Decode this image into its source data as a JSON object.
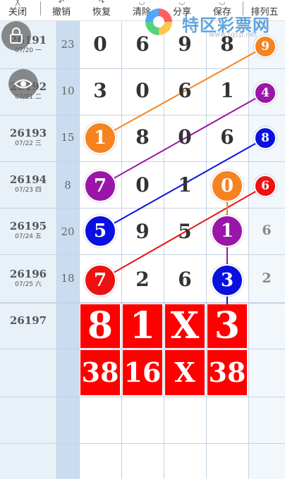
{
  "toolbar": {
    "items": [
      {
        "label": "关闭",
        "icon": "close-icon"
      },
      {
        "label": "撤销",
        "icon": "undo-icon"
      },
      {
        "label": "恢复",
        "icon": "redo-icon"
      },
      {
        "label": "清除",
        "icon": "clear-icon"
      },
      {
        "label": "分享",
        "icon": "share-icon"
      },
      {
        "label": "保存",
        "icon": "save-icon"
      },
      {
        "label": "排列五",
        "icon": "lottery-type"
      }
    ]
  },
  "watermark": {
    "text": "特区彩票网",
    "url": "www.tqcp.net"
  },
  "rows": [
    {
      "issue": "26191",
      "date": "07/20 一",
      "sum": "23",
      "digits": [
        "0",
        "6",
        "9",
        "8"
      ],
      "last": "9"
    },
    {
      "issue": "26192",
      "date": "07/21 二",
      "sum": "10",
      "digits": [
        "3",
        "0",
        "6",
        "1"
      ],
      "last": "4"
    },
    {
      "issue": "26193",
      "date": "07/22 三",
      "sum": "15",
      "digits": [
        "1",
        "8",
        "0",
        "6"
      ],
      "last": "8"
    },
    {
      "issue": "26194",
      "date": "07/23 四",
      "sum": "8",
      "digits": [
        "7",
        "0",
        "1",
        "0"
      ],
      "last": "6"
    },
    {
      "issue": "26195",
      "date": "07/24 五",
      "sum": "20",
      "digits": [
        "5",
        "9",
        "5",
        "1"
      ],
      "last": "6"
    },
    {
      "issue": "26196",
      "date": "07/25 六",
      "sum": "18",
      "digits": [
        "7",
        "2",
        "6",
        "3"
      ],
      "last": "2"
    }
  ],
  "next_issue": "26197",
  "prediction": {
    "top": [
      "8",
      "1",
      "X",
      "3"
    ],
    "bottom": [
      "38",
      "16",
      "X",
      "38"
    ]
  },
  "colors": {
    "orange": "#f5831f",
    "purple": "#9a16a8",
    "blue": "#0a10e0",
    "red": "#ee1111",
    "prediction_bg": "#ff0000"
  }
}
